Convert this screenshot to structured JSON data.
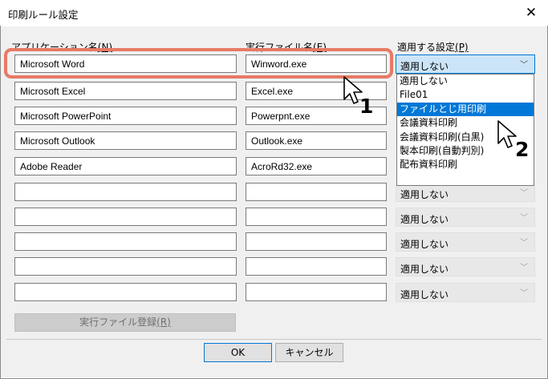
{
  "window": {
    "title": "印刷ルール設定",
    "close_glyph": "✕"
  },
  "headers": {
    "app_name": "アプリケーション名",
    "app_name_key": "(N)",
    "exe_name": "実行ファイル名",
    "exe_name_key": "(E)",
    "setting": "適用する設定",
    "setting_key": "(P)"
  },
  "rows": [
    {
      "app": "Microsoft Word",
      "exe": "Winword.exe",
      "setting": "適用しない"
    },
    {
      "app": "Microsoft Excel",
      "exe": "Excel.exe",
      "setting": ""
    },
    {
      "app": "Microsoft PowerPoint",
      "exe": "Powerpnt.exe",
      "setting": ""
    },
    {
      "app": "Microsoft Outlook",
      "exe": "Outlook.exe",
      "setting": ""
    },
    {
      "app": "Adobe Reader",
      "exe": "AcroRd32.exe",
      "setting": ""
    },
    {
      "app": "",
      "exe": "",
      "setting": "適用しない"
    },
    {
      "app": "",
      "exe": "",
      "setting": "適用しない"
    },
    {
      "app": "",
      "exe": "",
      "setting": "適用しない"
    },
    {
      "app": "",
      "exe": "",
      "setting": "適用しない"
    },
    {
      "app": "",
      "exe": "",
      "setting": "適用しない"
    }
  ],
  "dropdown": {
    "options": [
      "適用しない",
      "File01",
      "ファイルとじ用印刷",
      "会議資料印刷",
      "会議資料印刷(白黒)",
      "製本印刷(自動判別)",
      "配布資料印刷"
    ],
    "highlighted_index": 2
  },
  "buttons": {
    "register": "実行ファイル登録",
    "register_key": "(R)",
    "ok": "OK",
    "cancel": "キャンセル"
  },
  "callouts": {
    "step1": "1",
    "step2": "2"
  },
  "colors": {
    "highlight": "#e87964",
    "selection": "#0078d7"
  }
}
